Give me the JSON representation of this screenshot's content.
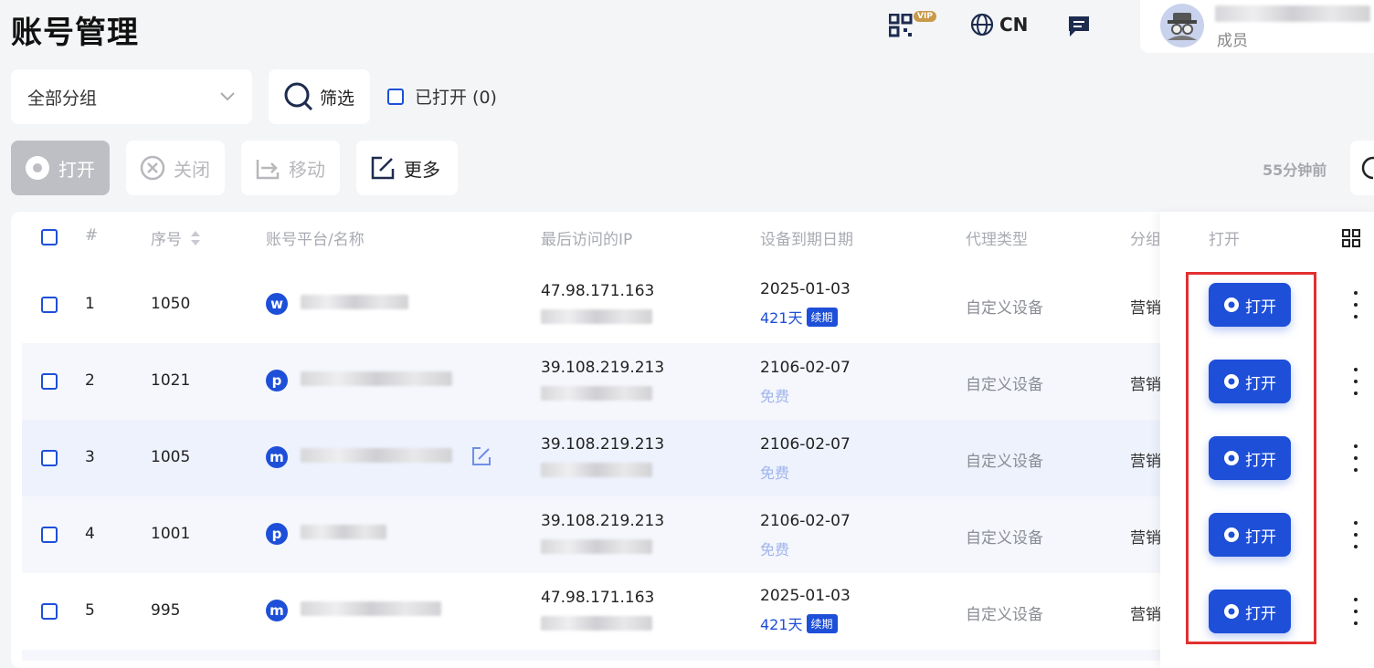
{
  "page": {
    "title": "账号管理"
  },
  "header": {
    "vip_badge": "VIP",
    "language": "CN",
    "user": {
      "role": "成员"
    }
  },
  "filters": {
    "group_select_value": "全部分组",
    "filter_label": "筛选",
    "opened_label": "已打开 (0)"
  },
  "toolbar": {
    "open_label": "打开",
    "close_label": "关闭",
    "move_label": "移动",
    "more_label": "更多",
    "updated_ago": "55分钟前"
  },
  "table": {
    "columns": {
      "index": "#",
      "serial": "序号",
      "platform_name": "账号平台/名称",
      "last_ip": "最后访问的IP",
      "expiry": "设备到期日期",
      "proxy_type": "代理类型",
      "group": "分组",
      "open": "打开"
    },
    "rows": [
      {
        "index": "1",
        "serial": "1050",
        "platform": "w",
        "ip": "47.98.171.163",
        "date": "2025-01-03",
        "days": "421天",
        "renew": "续期",
        "free": "",
        "proxy": "自定义设备",
        "group": "营销"
      },
      {
        "index": "2",
        "serial": "1021",
        "platform": "p",
        "ip": "39.108.219.213",
        "date": "2106-02-07",
        "days": "",
        "renew": "",
        "free": "免费",
        "proxy": "自定义设备",
        "group": "营销"
      },
      {
        "index": "3",
        "serial": "1005",
        "platform": "m",
        "ip": "39.108.219.213",
        "date": "2106-02-07",
        "days": "",
        "renew": "",
        "free": "免费",
        "proxy": "自定义设备",
        "group": "营销"
      },
      {
        "index": "4",
        "serial": "1001",
        "platform": "p",
        "ip": "39.108.219.213",
        "date": "2106-02-07",
        "days": "",
        "renew": "",
        "free": "免费",
        "proxy": "自定义设备",
        "group": "营销"
      },
      {
        "index": "5",
        "serial": "995",
        "platform": "m",
        "ip": "47.98.171.163",
        "date": "2025-01-03",
        "days": "421天",
        "renew": "续期",
        "free": "",
        "proxy": "自定义设备",
        "group": "营销"
      }
    ],
    "open_button_label": "打开"
  },
  "colors": {
    "accent": "#1e4fd8",
    "highlight": "#e23030"
  }
}
